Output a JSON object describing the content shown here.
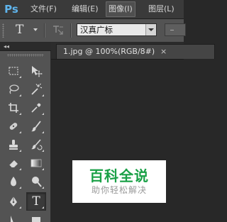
{
  "app": {
    "logo": "Ps"
  },
  "menu": {
    "items": [
      {
        "label": "文件(F)",
        "active": false
      },
      {
        "label": "编辑(E)",
        "active": false
      },
      {
        "label": "图像(I)",
        "active": true
      },
      {
        "label": "图层(L)",
        "active": false
      }
    ]
  },
  "options": {
    "tool_letter": "T",
    "font_family": "汉真广标"
  },
  "tools_panel": {
    "collapse_glyph": "◂◂",
    "text_tool_letter": "T",
    "tools": [
      "rectangular-marquee-icon",
      "move-icon",
      "lasso-icon",
      "magic-wand-icon",
      "crop-icon",
      "eyedropper-icon",
      "spot-healing-icon",
      "brush-icon",
      "clone-stamp-icon",
      "history-brush-icon",
      "eraser-icon",
      "gradient-icon",
      "blur-icon",
      "dodge-icon",
      "pen-icon",
      "type-icon"
    ],
    "selected": "type-icon"
  },
  "document": {
    "tab_label": "1.jpg @ 100%(RGB/8#)",
    "close_glyph": "×"
  },
  "watermark": {
    "title": "百科全说",
    "subtitle": "助你轻松解决"
  },
  "colors": {
    "menubar_bg": "#3a3a3a",
    "panel_bg": "#535353",
    "canvas_bg": "#282828",
    "logo": "#5fb4ec",
    "watermark_green": "#19a046"
  }
}
